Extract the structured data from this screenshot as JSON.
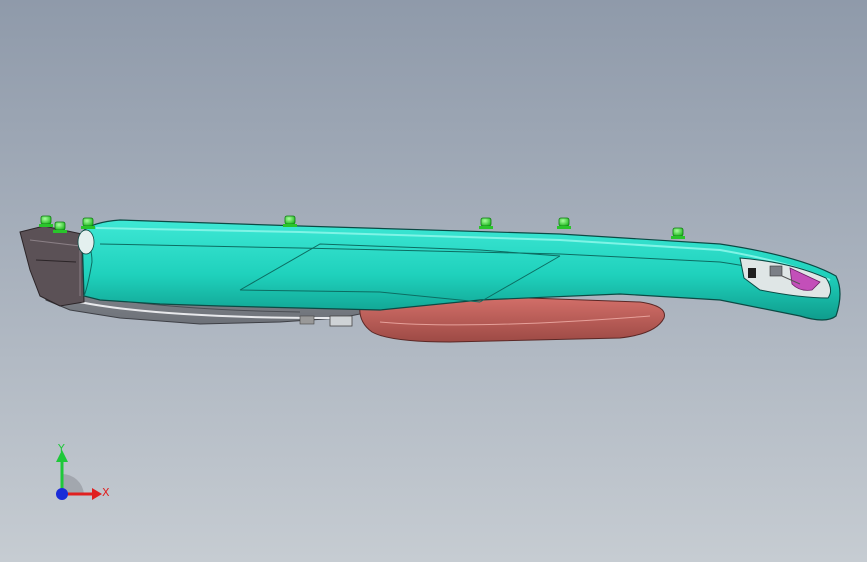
{
  "viewport": {
    "model": "cad-model"
  },
  "triad": {
    "x_label": "X",
    "y_label": "Y",
    "colors": {
      "x": "#e02020",
      "y": "#1fc83a",
      "z": "#1a2bd8"
    }
  },
  "colors": {
    "background_top": "#8f9aaa",
    "background_bottom": "#c6ccd2",
    "housing": "#22d7c2",
    "housing_dark": "#119a8c",
    "lens": "#c25e58",
    "fasteners": "#3fe044",
    "inner_detail": "#5a4f55"
  }
}
